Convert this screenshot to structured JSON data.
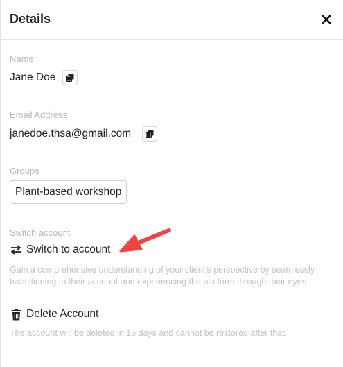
{
  "header": {
    "title": "Details"
  },
  "name": {
    "label": "Name",
    "value": "Jane Doe"
  },
  "email": {
    "label": "Email Address",
    "value": "janedoe.thsa@gmail.com"
  },
  "groups": {
    "label": "Groups",
    "items": [
      "Plant-based workshop"
    ]
  },
  "switch": {
    "label": "Switch account",
    "action": "Switch to account",
    "description_line1": "Gain a comprehensive understanding of your client's perspective by seamlessly",
    "description_line2": "transitioning to their account and experiencing the platform through their eyes."
  },
  "delete": {
    "action": "Delete Account",
    "description": "The account will be deleted in 15 days and cannot be restored after that."
  },
  "colors": {
    "annotation_arrow": "#ee4444"
  }
}
